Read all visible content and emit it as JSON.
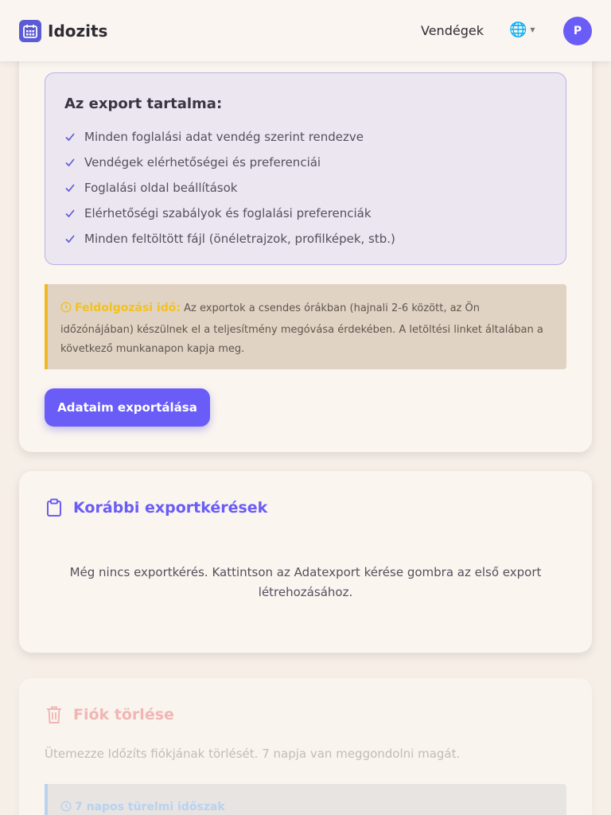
{
  "header": {
    "app_name": "Idozits",
    "nav_guests": "Vendégek",
    "language_icon": "globe-icon",
    "avatar_initial": "P"
  },
  "export_section": {
    "contents_title": "Az export tartalma:",
    "items": [
      "Minden foglalási adat vendég szerint rendezve",
      "Vendégek elérhetőségei és preferenciái",
      "Foglalási oldal beállítások",
      "Elérhetőségi szabályok és foglalási preferenciák",
      "Minden feltöltött fájl (önéletrajzok, profilképek, stb.)"
    ],
    "notice_title": "Feldolgozási idő:",
    "notice_text": "Az exportok a csendes órákban (hajnali 2-6 között, az Ön időzónájában) készülnek el a teljesítmény megóvása érdekében. A letöltési linket általában a következő munkanapon kapja meg.",
    "export_button": "Adataim exportálása"
  },
  "previous_requests": {
    "title": "Korábbi exportkérések",
    "empty_text": "Még nincs exportkérés. Kattintson az Adatexport kérése gombra az első export létrehozásához."
  },
  "delete_account": {
    "title": "Fiók törlése",
    "description": "Ütemezze Időzíts fiókjának törlését. 7 napja van meggondolni magát.",
    "grace_title": "7 napos türelmi időszak"
  },
  "colors": {
    "accent": "#6a5cf6",
    "warning": "#f2b823",
    "danger_faded": "#f1b6b4",
    "info_faded": "#b9d3f0"
  }
}
